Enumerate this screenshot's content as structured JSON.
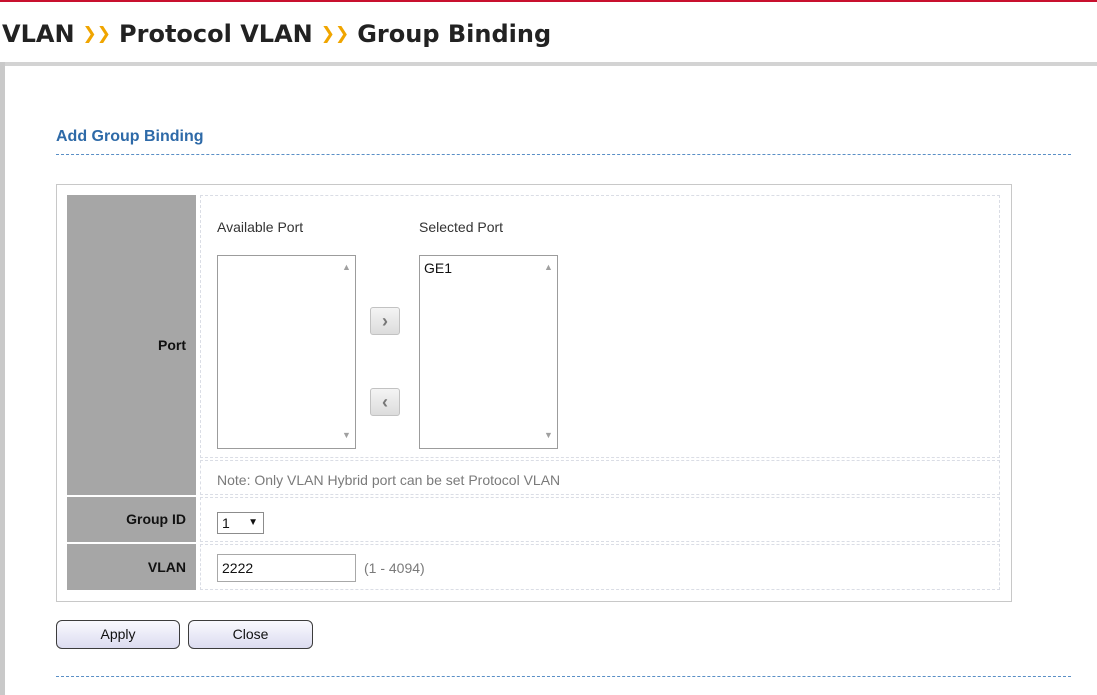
{
  "breadcrumb": {
    "items": [
      "VLAN",
      "Protocol VLAN",
      "Group Binding"
    ],
    "separator": "❯❯"
  },
  "section": {
    "title": "Add Group Binding"
  },
  "form": {
    "port": {
      "label": "Port",
      "available_header": "Available Port",
      "selected_header": "Selected Port",
      "available_items": [],
      "selected_items": [
        "GE1"
      ],
      "add_icon": "chevron-right-icon",
      "remove_icon": "chevron-left-icon",
      "note": "Note: Only VLAN Hybrid port can be set Protocol VLAN"
    },
    "group_id": {
      "label": "Group ID",
      "value": "1"
    },
    "vlan": {
      "label": "VLAN",
      "value": "2222",
      "range": "(1 - 4094)"
    }
  },
  "buttons": {
    "apply": "Apply",
    "close": "Close"
  },
  "colors": {
    "accent_red": "#c8102e",
    "section_title": "#2e6aa8",
    "separator": "#f0a500",
    "label_bg": "#a6a6a6"
  }
}
